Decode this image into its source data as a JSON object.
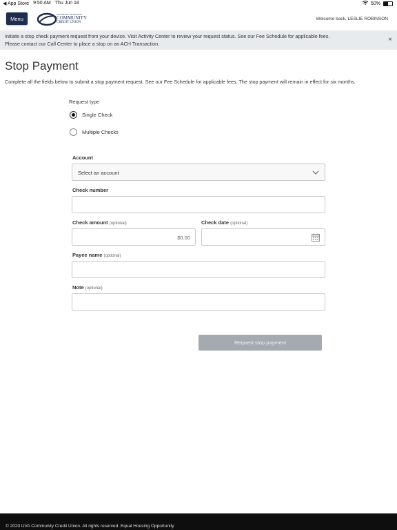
{
  "status_bar": {
    "back_app": "◀ App Store",
    "time": "9:50 AM",
    "date": "Thu Jun 18",
    "battery": "50%",
    "battery_level": 0.5
  },
  "header": {
    "menu_label": "Menu",
    "logo": {
      "line_small": "UNIVERSITY OF VIRGINIA",
      "line_big": "COMMUNITY",
      "line_mid": "CREDIT UNION",
      "brand_color": "#1f2d4e"
    },
    "welcome": "Welcome back, LESLIE ROBINSON"
  },
  "banner": {
    "line1": "Initiate a stop check payment request from your device. Visit Activity Center to review your request status. See our Fee Schedule for applicable fees.",
    "line2": "Please contact our Call Center to place a stop on an ACH Transaction.",
    "close_icon": "×"
  },
  "page": {
    "title": "Stop Payment",
    "intro": "Complete all the fields below to submit a stop payment request. See our Fee Schedule for applicable fees. The stop payment will remain in effect for six months."
  },
  "form": {
    "request_type_label": "Request type",
    "options": [
      {
        "label": "Single Check",
        "selected": true
      },
      {
        "label": "Multiple Checks",
        "selected": false
      }
    ],
    "account": {
      "label": "Account",
      "placeholder": "Select an account"
    },
    "check_number": {
      "label": "Check number",
      "value": ""
    },
    "check_amount": {
      "label": "Check amount",
      "optional": "(optional)",
      "value": "$0.00"
    },
    "check_date": {
      "label": "Check date",
      "optional": "(optional)",
      "value": ""
    },
    "payee_name": {
      "label": "Payee name",
      "optional": "(optional)",
      "value": ""
    },
    "note": {
      "label": "Note",
      "optional": "(optional)",
      "value": ""
    },
    "submit_label": "Request stop payment"
  },
  "footer": {
    "text": "© 2020 UVA Community Credit Union. All rights reserved.  Equal Housing Opportunity"
  }
}
